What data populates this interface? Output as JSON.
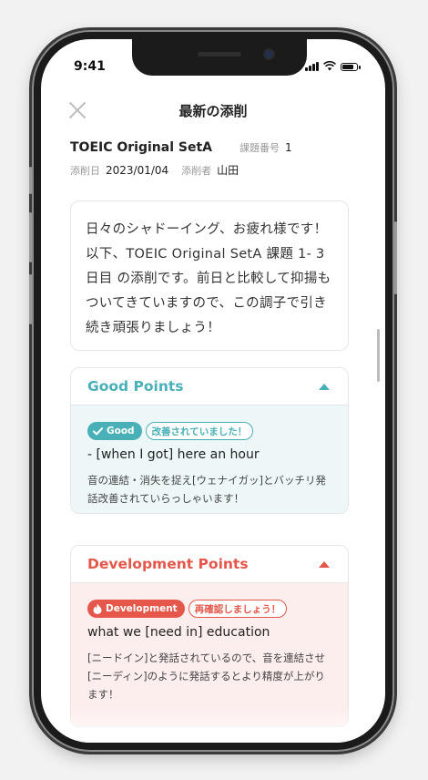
{
  "status_bar": {
    "time": "9:41"
  },
  "navbar": {
    "title": "最新の添削"
  },
  "meta": {
    "set_name": "TOEIC Original SetA",
    "task_label": "課題番号",
    "task_number": "1",
    "date_label": "添削日",
    "date": "2023/01/04",
    "corrector_label": "添削者",
    "corrector": "山田"
  },
  "message": "日々のシャドーイング、お疲れ様です！以下、TOEIC Original SetA 課題 1- 3日目 の添削です。前日と比較して抑揚もついてきていますので、この調子で引き続き頑張りましょう！",
  "good_points": {
    "title": "Good Points",
    "tag": "Good",
    "badge": "改善されていました！",
    "phrase": "- [when I got] here an hour",
    "note": "音の連結・消失を捉え[ウェナイガッ]とバッチリ発話改善されていらっしゃいます！",
    "color": "#4ab0b8"
  },
  "development_points": {
    "title": "Development Points",
    "tag": "Development",
    "badge": "再確認しましょう！",
    "phrase": "what we [need in] education",
    "note": "[ニードイン]と発話されているので、音を連結させ[ニーディン]のように発話するとより精度が上がります！",
    "color": "#e5574b"
  }
}
